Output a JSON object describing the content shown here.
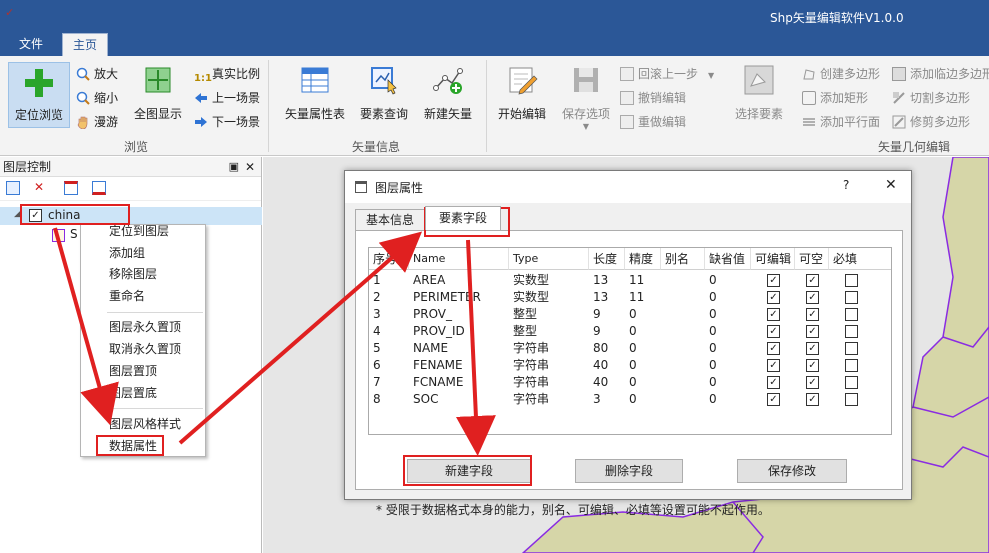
{
  "app": {
    "title": "Shp矢量编辑软件V1.0.0"
  },
  "tabs": [
    {
      "label": "文件"
    },
    {
      "label": "主页"
    }
  ],
  "ribbon": {
    "browse": {
      "label": "浏览",
      "locate": "定位浏览",
      "zoom_in": "放大",
      "zoom_out": "缩小",
      "pan": "漫游",
      "full_extent": "全图显示",
      "real_scale": "真实比例",
      "prev_view": "上一场景",
      "next_view": "下一场景"
    },
    "vector_info": {
      "label": "矢量信息",
      "attr_table": "矢量属性表",
      "feature_query": "要素查询",
      "new_vector": "新建矢量"
    },
    "geometry": {
      "label": "矢量几何编辑",
      "start_edit": "开始编辑",
      "save_options": "保存选项",
      "rollback": "回滚上一步",
      "undo": "撤销编辑",
      "redo": "重做编辑",
      "select_feature": "选择要素",
      "create_polygon": "创建多边形",
      "add_rect": "添加矩形",
      "add_parallel": "添加平行面",
      "add_adjacent": "添加临边多边形",
      "cut_polygon": "切割多边形",
      "trim_polygon": "修剪多边形"
    }
  },
  "layer_panel": {
    "title": "图层控制",
    "layer_name": "china",
    "sublayer": "S"
  },
  "context_menu": {
    "items": [
      "定位到图层",
      "添加组",
      "移除图层",
      "重命名",
      "图层永久置顶",
      "取消永久置顶",
      "图层置顶",
      "图层置底",
      "图层风格样式",
      "数据属性"
    ]
  },
  "dialog": {
    "title": "图层属性",
    "help": "?",
    "close": "✕",
    "tabs": [
      "基本信息",
      "要素字段"
    ],
    "columns": [
      "序号",
      "Name",
      "Type",
      "长度",
      "精度",
      "别名",
      "缺省值",
      "可编辑",
      "可空",
      "必填"
    ],
    "rows": [
      {
        "no": "1",
        "name": "AREA",
        "type": "实数型",
        "len": "13",
        "prec": "11",
        "alias": "",
        "def": "0",
        "edit": true,
        "nullable": true,
        "required": false
      },
      {
        "no": "2",
        "name": "PERIMETER",
        "type": "实数型",
        "len": "13",
        "prec": "11",
        "alias": "",
        "def": "0",
        "edit": true,
        "nullable": true,
        "required": false
      },
      {
        "no": "3",
        "name": "PROV_",
        "type": "整型",
        "len": "9",
        "prec": "0",
        "alias": "",
        "def": "0",
        "edit": true,
        "nullable": true,
        "required": false
      },
      {
        "no": "4",
        "name": "PROV_ID",
        "type": "整型",
        "len": "9",
        "prec": "0",
        "alias": "",
        "def": "0",
        "edit": true,
        "nullable": true,
        "required": false
      },
      {
        "no": "5",
        "name": "NAME",
        "type": "字符串",
        "len": "80",
        "prec": "0",
        "alias": "",
        "def": "0",
        "edit": true,
        "nullable": true,
        "required": false
      },
      {
        "no": "6",
        "name": "FENAME",
        "type": "字符串",
        "len": "40",
        "prec": "0",
        "alias": "",
        "def": "0",
        "edit": true,
        "nullable": true,
        "required": false
      },
      {
        "no": "7",
        "name": "FCNAME",
        "type": "字符串",
        "len": "40",
        "prec": "0",
        "alias": "",
        "def": "0",
        "edit": true,
        "nullable": true,
        "required": false
      },
      {
        "no": "8",
        "name": "SOC",
        "type": "字符串",
        "len": "3",
        "prec": "0",
        "alias": "",
        "def": "0",
        "edit": true,
        "nullable": true,
        "required": false
      }
    ],
    "note": "* 受限于数据格式本身的能力，别名、可编辑、必填等设置可能不起作用。",
    "buttons": {
      "new_field": "新建字段",
      "delete_field": "删除字段",
      "save": "保存修改"
    }
  },
  "colors": {
    "title_bar": "#2b5797",
    "highlight": "#e02020",
    "map_fill": "#d6d6a8",
    "border_line": "#8a2be2"
  }
}
